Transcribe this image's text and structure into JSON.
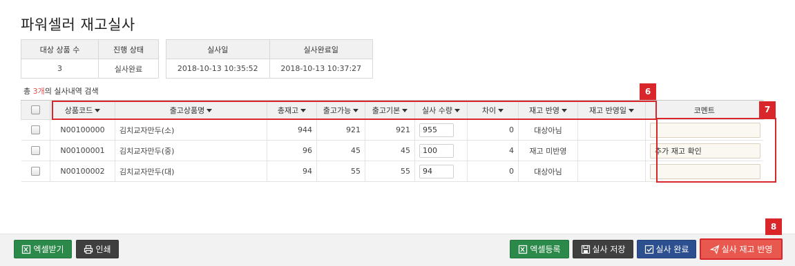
{
  "title": "파워셀러 재고실사",
  "summary1": {
    "headers": [
      "대상 상품 수",
      "진행 상태"
    ],
    "values": [
      "3",
      "실사완료"
    ]
  },
  "summary2": {
    "headers": [
      "실사일",
      "실사완료일"
    ],
    "values": [
      "2018-10-13 10:35:52",
      "2018-10-13 10:37:27"
    ]
  },
  "result": {
    "prefix": "총 ",
    "count": "3개",
    "suffix": "의 실사내역 검색"
  },
  "grid": {
    "columns": [
      "상품코드",
      "출고상품명",
      "총재고",
      "출고가능",
      "출고기본",
      "실사 수량",
      "차이",
      "재고 반영",
      "재고 반영일",
      "코멘트"
    ],
    "rows": [
      {
        "code": "N00100000",
        "name": "김치교자만두(소)",
        "total": "944",
        "avail": "921",
        "base": "921",
        "qty": "955",
        "diff": "0",
        "status": "대상아님",
        "date": "",
        "comment": ""
      },
      {
        "code": "N00100001",
        "name": "김치교자만두(중)",
        "total": "96",
        "avail": "45",
        "base": "45",
        "qty": "100",
        "diff": "4",
        "status": "재고 미반영",
        "date": "",
        "comment": "추가 재고 확인"
      },
      {
        "code": "N00100002",
        "name": "김치교자만두(대)",
        "total": "94",
        "avail": "55",
        "base": "55",
        "qty": "94",
        "diff": "0",
        "status": "대상아님",
        "date": "",
        "comment": ""
      }
    ]
  },
  "annotations": {
    "a6": "6",
    "a7": "7",
    "a8": "8"
  },
  "footer": {
    "excel_download": "엑셀받기",
    "print": "인쇄",
    "excel_upload": "엑셀등록",
    "save": "실사 저장",
    "complete": "실사 완료",
    "apply": "실사 재고 반영"
  },
  "colors": {
    "accent_red": "#d9262b",
    "green": "#2b8a4a",
    "navy": "#2c4f8f",
    "apply_red": "#e8584e"
  }
}
